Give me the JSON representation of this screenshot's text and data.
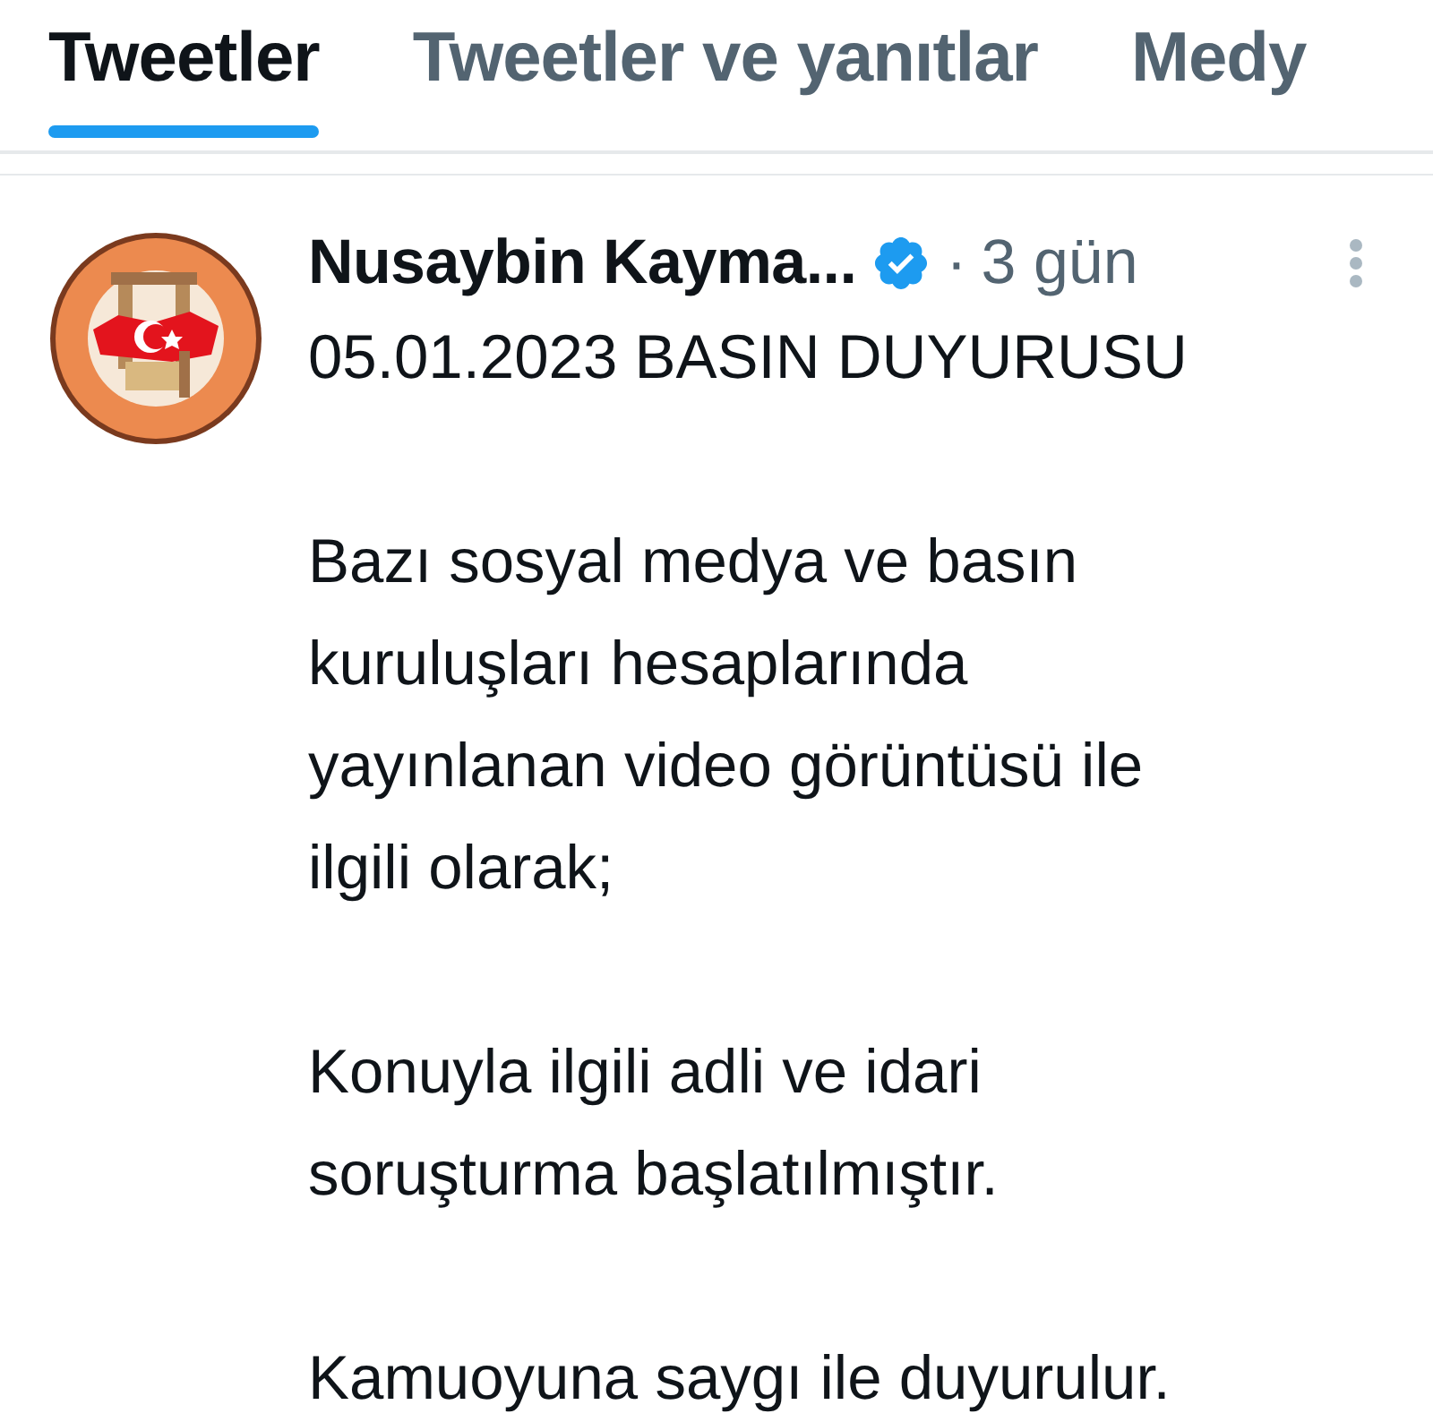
{
  "tabs": [
    {
      "label": "Tweetler",
      "selected": true
    },
    {
      "label": "Tweetler ve yanıtlar",
      "selected": false
    },
    {
      "label": "Medy",
      "selected": false
    }
  ],
  "tweet": {
    "author": "Nusaybin Kayma...",
    "verified": true,
    "separator": "·",
    "time": "3 gün",
    "paragraphs": [
      [
        "05.01.2023 BASIN DUYURUSU"
      ],
      [
        "Bazı sosyal medya ve basın",
        "kuruluşları hesaplarında",
        "yayınlanan video görüntüsü ile",
        "ilgili olarak;"
      ],
      [
        "Konuyla ilgili adli ve idari",
        "soruşturma başlatılmıştır."
      ],
      [
        "Kamuoyuna saygı ile duyurulur."
      ]
    ]
  }
}
